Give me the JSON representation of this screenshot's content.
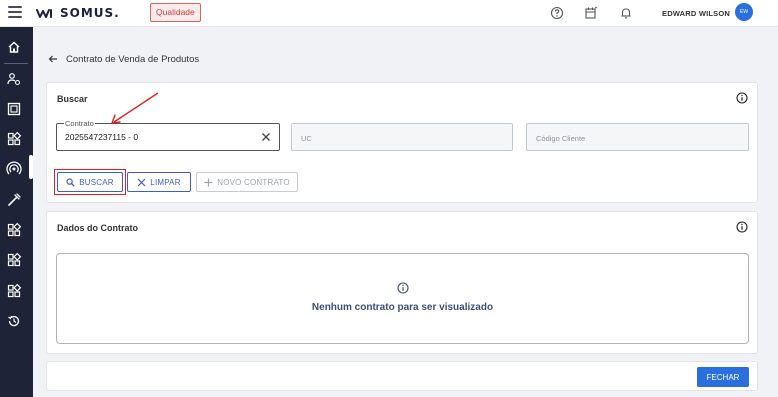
{
  "header": {
    "logo_text": "SOMUS.",
    "environment_badge": "Qualidade",
    "user_name": "EDWARD WILSON",
    "avatar_initials": "EW",
    "icons": [
      "help-icon",
      "calendar-icon",
      "bell-icon"
    ]
  },
  "sidebar": {
    "items": [
      "home-icon",
      "people-icon",
      "calculator-icon",
      "grid-icon",
      "broadcast-icon",
      "tools-icon",
      "grid-icon",
      "grid-icon",
      "grid-icon",
      "history-icon"
    ],
    "active_index": 4
  },
  "page": {
    "title": "Contrato de Venda de Produtos"
  },
  "search": {
    "title": "Buscar",
    "contrato_label": "Contrato",
    "contrato_value": "2025547237115 - 0",
    "uc_placeholder": "UC",
    "codigo_cliente_placeholder": "Código Cliente",
    "buscar_label": "BUSCAR",
    "limpar_label": "LIMPAR",
    "novo_contrato_label": "NOVO CONTRATO"
  },
  "contract_data": {
    "title": "Dados do Contrato",
    "empty_message": "Nenhum contrato para ser visualizado"
  },
  "footer": {
    "fechar_label": "FECHAR"
  },
  "colors": {
    "primary": "#2a6fe0",
    "sidebar_bg": "#1e2337",
    "annotation_red": "#e02020"
  }
}
